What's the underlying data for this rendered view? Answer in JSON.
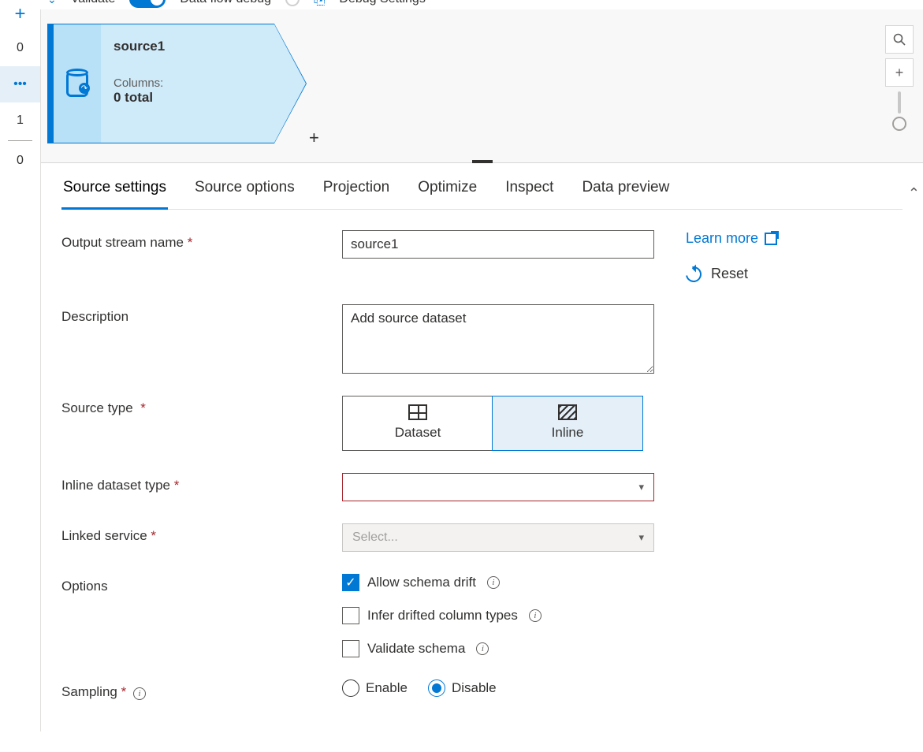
{
  "toolbar": {
    "validate": "Validate",
    "debug_toggle_label": "Data flow debug",
    "debug_toggle_on": true,
    "debug_settings": "Debug Settings"
  },
  "rail": {
    "counts": [
      "0",
      "",
      "1",
      "0"
    ]
  },
  "node": {
    "title": "source1",
    "columns_label": "Columns:",
    "columns_value": "0 total"
  },
  "tabs": [
    "Source settings",
    "Source options",
    "Projection",
    "Optimize",
    "Inspect",
    "Data preview"
  ],
  "active_tab": "Source settings",
  "side": {
    "learn_more": "Learn more",
    "reset": "Reset"
  },
  "form": {
    "output_stream_name": {
      "label": "Output stream name",
      "required": true,
      "value": "source1"
    },
    "description": {
      "label": "Description",
      "value": "Add source dataset"
    },
    "source_type": {
      "label": "Source type",
      "required": true,
      "options": [
        "Dataset",
        "Inline"
      ],
      "selected": "Inline"
    },
    "inline_dataset_type": {
      "label": "Inline dataset type",
      "required": true,
      "value": ""
    },
    "linked_service": {
      "label": "Linked service",
      "required": true,
      "placeholder": "Select..."
    },
    "options": {
      "label": "Options",
      "allow_schema_drift": {
        "label": "Allow schema drift",
        "checked": true
      },
      "infer_drifted": {
        "label": "Infer drifted column types",
        "checked": false
      },
      "validate_schema": {
        "label": "Validate schema",
        "checked": false
      }
    },
    "sampling": {
      "label": "Sampling",
      "required": true,
      "enable": "Enable",
      "disable": "Disable",
      "value": "Disable"
    }
  }
}
